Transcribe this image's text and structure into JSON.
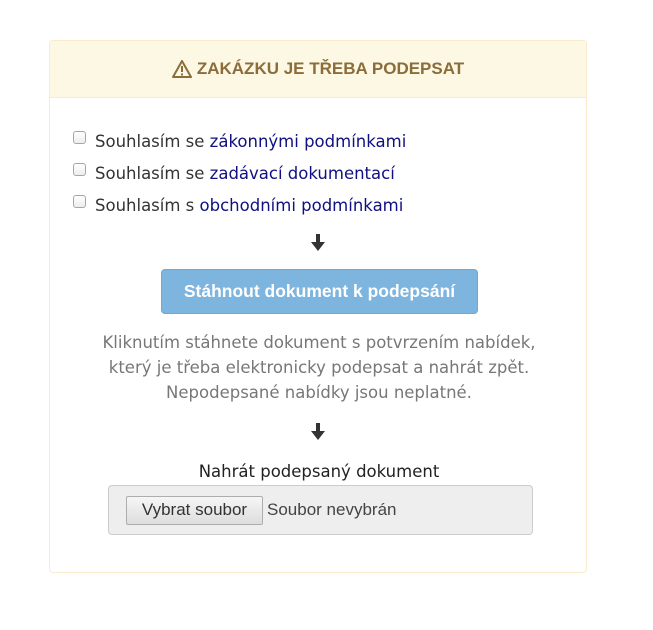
{
  "header": {
    "title": "ZAKÁZKU JE TŘEBA PODEPSAT",
    "icon": "warning-icon"
  },
  "agreements": [
    {
      "prefix": "Souhlasím se ",
      "link": "zákonnými podmínkami",
      "checked": false
    },
    {
      "prefix": "Souhlasím se ",
      "link": "zadávací dokumentací",
      "checked": false
    },
    {
      "prefix": "Souhlasím s ",
      "link": "obchodními podmínkami",
      "checked": false
    }
  ],
  "download": {
    "label": "Stáhnout dokument k podepsání"
  },
  "info": {
    "line1": "Kliknutím stáhnete dokument s potvrzením nabídek,",
    "line2": "který je třeba elektronicky podepsat a nahrát zpět.",
    "line3": "Nepodepsané nabídky jsou neplatné."
  },
  "upload": {
    "label": "Nahrát podepsaný dokument",
    "button_label": "Vybrat soubor",
    "status": "Soubor nevybrán"
  },
  "colors": {
    "panel_border": "#faebcc",
    "heading_bg": "#fcf8e3",
    "heading_text": "#8a6d3b",
    "link": "#101080",
    "button_bg": "#7eb5df",
    "info_text": "#777777"
  }
}
